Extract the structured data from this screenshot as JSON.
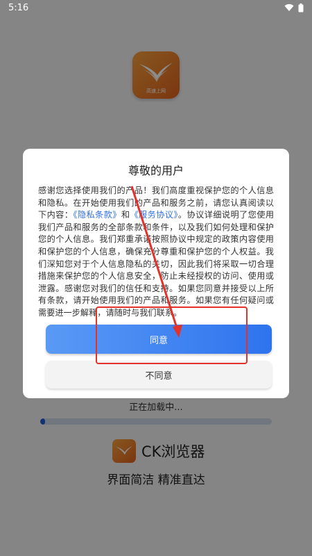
{
  "status_bar": {
    "time": "5:16"
  },
  "splash": {
    "logo_caption": "高速上网",
    "loading_text": "正在加载中...",
    "progress_fraction": 0.02,
    "brand_name": "CK浏览器",
    "slogan": "界面简洁 精准直达"
  },
  "dialog": {
    "title": "尊敬的用户",
    "body_part1": "感谢您选择使用我们的产品！我们高度重视保护您的个人信息和隐私。在开始使用我们的产品和服务之前，请您认真阅读以下内容：",
    "privacy_link": "《隐私条款》",
    "and_text": "和",
    "service_link": "《服务协议》",
    "body_part2": "。协议详细说明了您使用我们产品和服务的全部条款和条件，以及我们如何处理和保护您的个人信息。我们郑重承诺按照协议中规定的政策内容使用和保护您的个人信息，确保充分尊重和保护您的个人权益。我们深知您对于个人信息隐私的关切，因此我们将采取一切合理措施来保护您的个人信息安全，防止未经授权的访问、使用或泄露。感谢您对我们的信任和支持。如果您同意并接受以上所有条款，请开始使用我们的产品和服务。如果您有任何疑问或需要进一步解释，请随时与我们联系。",
    "agree_label": "同意",
    "disagree_label": "不同意"
  },
  "colors": {
    "accent": "#2e73ee",
    "annotation": "#e2322b",
    "logo_orange": "#e0611d"
  }
}
